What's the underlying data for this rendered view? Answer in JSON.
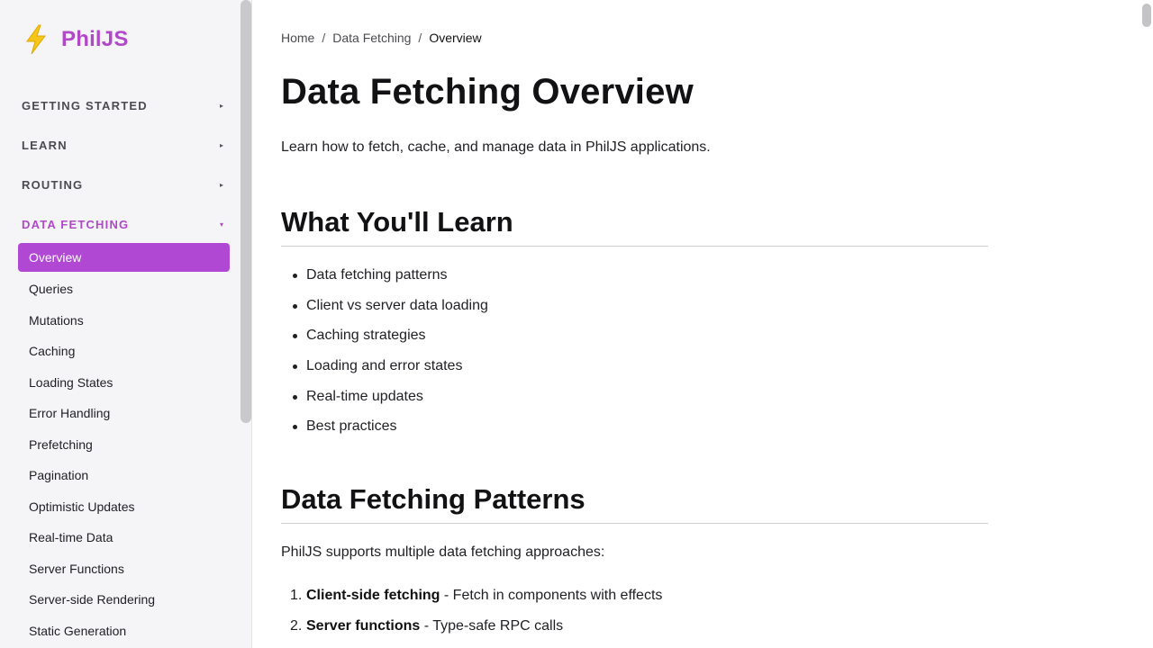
{
  "brand": {
    "name": "PhilJS",
    "icon": "lightning-bolt-icon",
    "accent": "#b048c8"
  },
  "sidebar": {
    "sections": [
      {
        "label": "GETTING STARTED",
        "arrow": "▸",
        "expanded": false
      },
      {
        "label": "LEARN",
        "arrow": "▸",
        "expanded": false
      },
      {
        "label": "ROUTING",
        "arrow": "▸",
        "expanded": false
      },
      {
        "label": "DATA FETCHING",
        "arrow": "▾",
        "expanded": true
      }
    ],
    "items": [
      {
        "label": "Overview",
        "active": true
      },
      {
        "label": "Queries"
      },
      {
        "label": "Mutations"
      },
      {
        "label": "Caching"
      },
      {
        "label": "Loading States"
      },
      {
        "label": "Error Handling"
      },
      {
        "label": "Prefetching"
      },
      {
        "label": "Pagination"
      },
      {
        "label": "Optimistic Updates"
      },
      {
        "label": "Real-time Data"
      },
      {
        "label": "Server Functions"
      },
      {
        "label": "Server-side Rendering"
      },
      {
        "label": "Static Generation"
      }
    ]
  },
  "breadcrumb": {
    "items": [
      "Home",
      "Data Fetching",
      "Overview"
    ],
    "separator": "/"
  },
  "page": {
    "title": "Data Fetching Overview",
    "intro": "Learn how to fetch, cache, and manage data in PhilJS applications.",
    "learn_heading": "What You'll Learn",
    "learn_items": [
      "Data fetching patterns",
      "Client vs server data loading",
      "Caching strategies",
      "Loading and error states",
      "Real-time updates",
      "Best practices"
    ],
    "patterns_heading": "Data Fetching Patterns",
    "patterns_intro": "PhilJS supports multiple data fetching approaches:",
    "patterns": [
      {
        "num": "1.",
        "title": "Client-side fetching",
        "desc": " - Fetch in components with effects"
      },
      {
        "num": "2.",
        "title": "Server functions",
        "desc": " - Type-safe RPC calls"
      }
    ]
  }
}
